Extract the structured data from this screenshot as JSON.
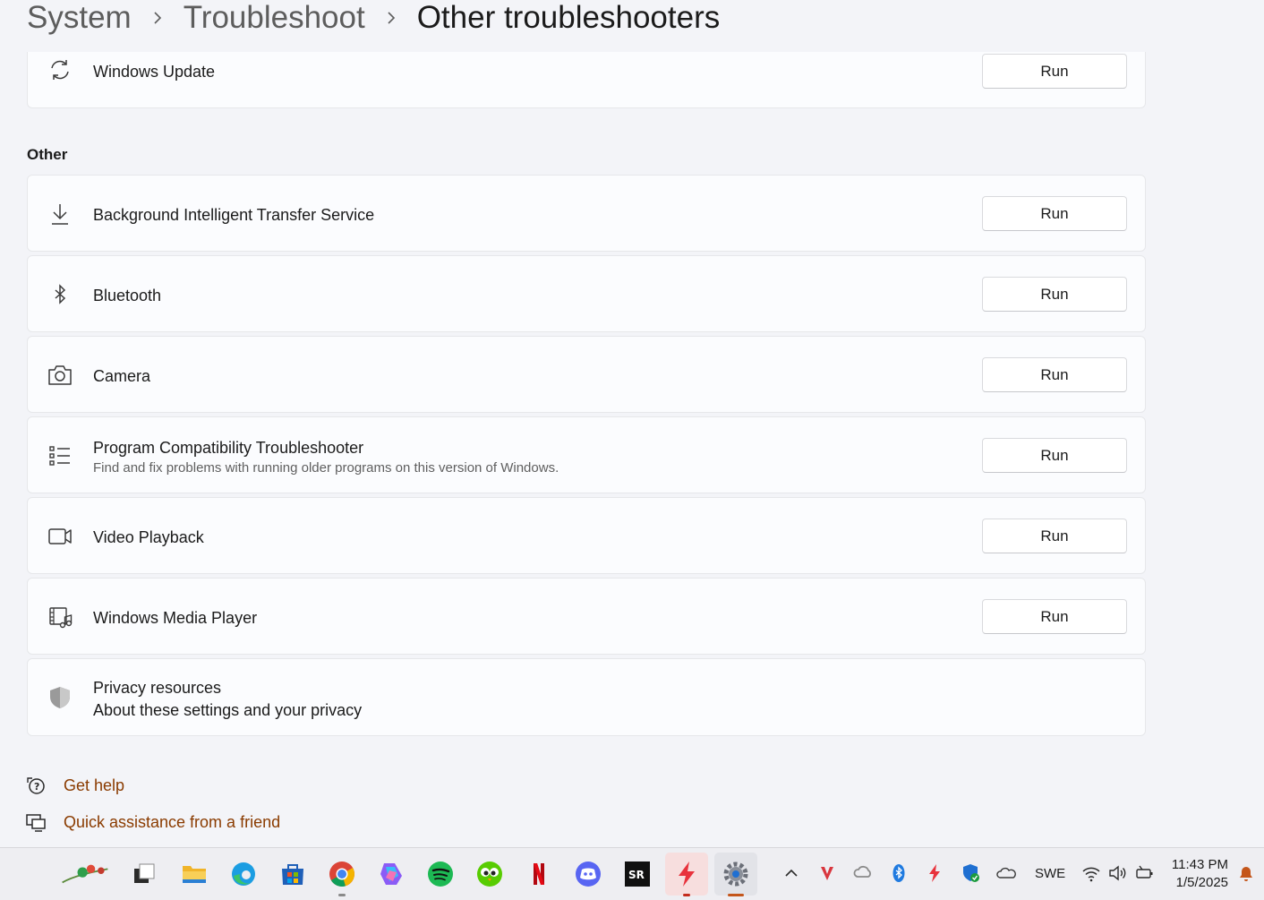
{
  "breadcrumb": {
    "items": [
      "System",
      "Troubleshoot",
      "Other troubleshooters"
    ]
  },
  "top_item": {
    "title": "Windows Update",
    "button": "Run",
    "icon": "refresh-icon"
  },
  "other_section": {
    "heading": "Other",
    "items": [
      {
        "title": "Background Intelligent Transfer Service",
        "desc": "",
        "button": "Run",
        "icon": "download-icon"
      },
      {
        "title": "Bluetooth",
        "desc": "",
        "button": "Run",
        "icon": "bluetooth-icon"
      },
      {
        "title": "Camera",
        "desc": "",
        "button": "Run",
        "icon": "camera-icon"
      },
      {
        "title": "Program Compatibility Troubleshooter",
        "desc": "Find and fix problems with running older programs on this version of Windows.",
        "button": "Run",
        "icon": "list-icon"
      },
      {
        "title": "Video Playback",
        "desc": "",
        "button": "Run",
        "icon": "video-icon"
      },
      {
        "title": "Windows Media Player",
        "desc": "",
        "button": "Run",
        "icon": "media-player-icon"
      }
    ]
  },
  "privacy": {
    "title": "Privacy resources",
    "link": "About these settings and your privacy",
    "icon": "shield-icon"
  },
  "help_links": {
    "get_help": "Get help",
    "quick_assist": "Quick assistance from a friend"
  },
  "taskbar": {
    "apps": [
      "widgets",
      "file-explorer",
      "edge",
      "store",
      "chrome",
      "copilot",
      "spotify",
      "duolingo",
      "netflix",
      "discord",
      "sr-app",
      "flash-app",
      "settings"
    ],
    "tray": {
      "language": "SWE",
      "time": "11:43 PM",
      "date": "1/5/2025"
    }
  },
  "colors": {
    "link": "#8a3b00",
    "accent": "#c4561b",
    "background": "#f3f4f8",
    "card": "#fbfcfe"
  }
}
